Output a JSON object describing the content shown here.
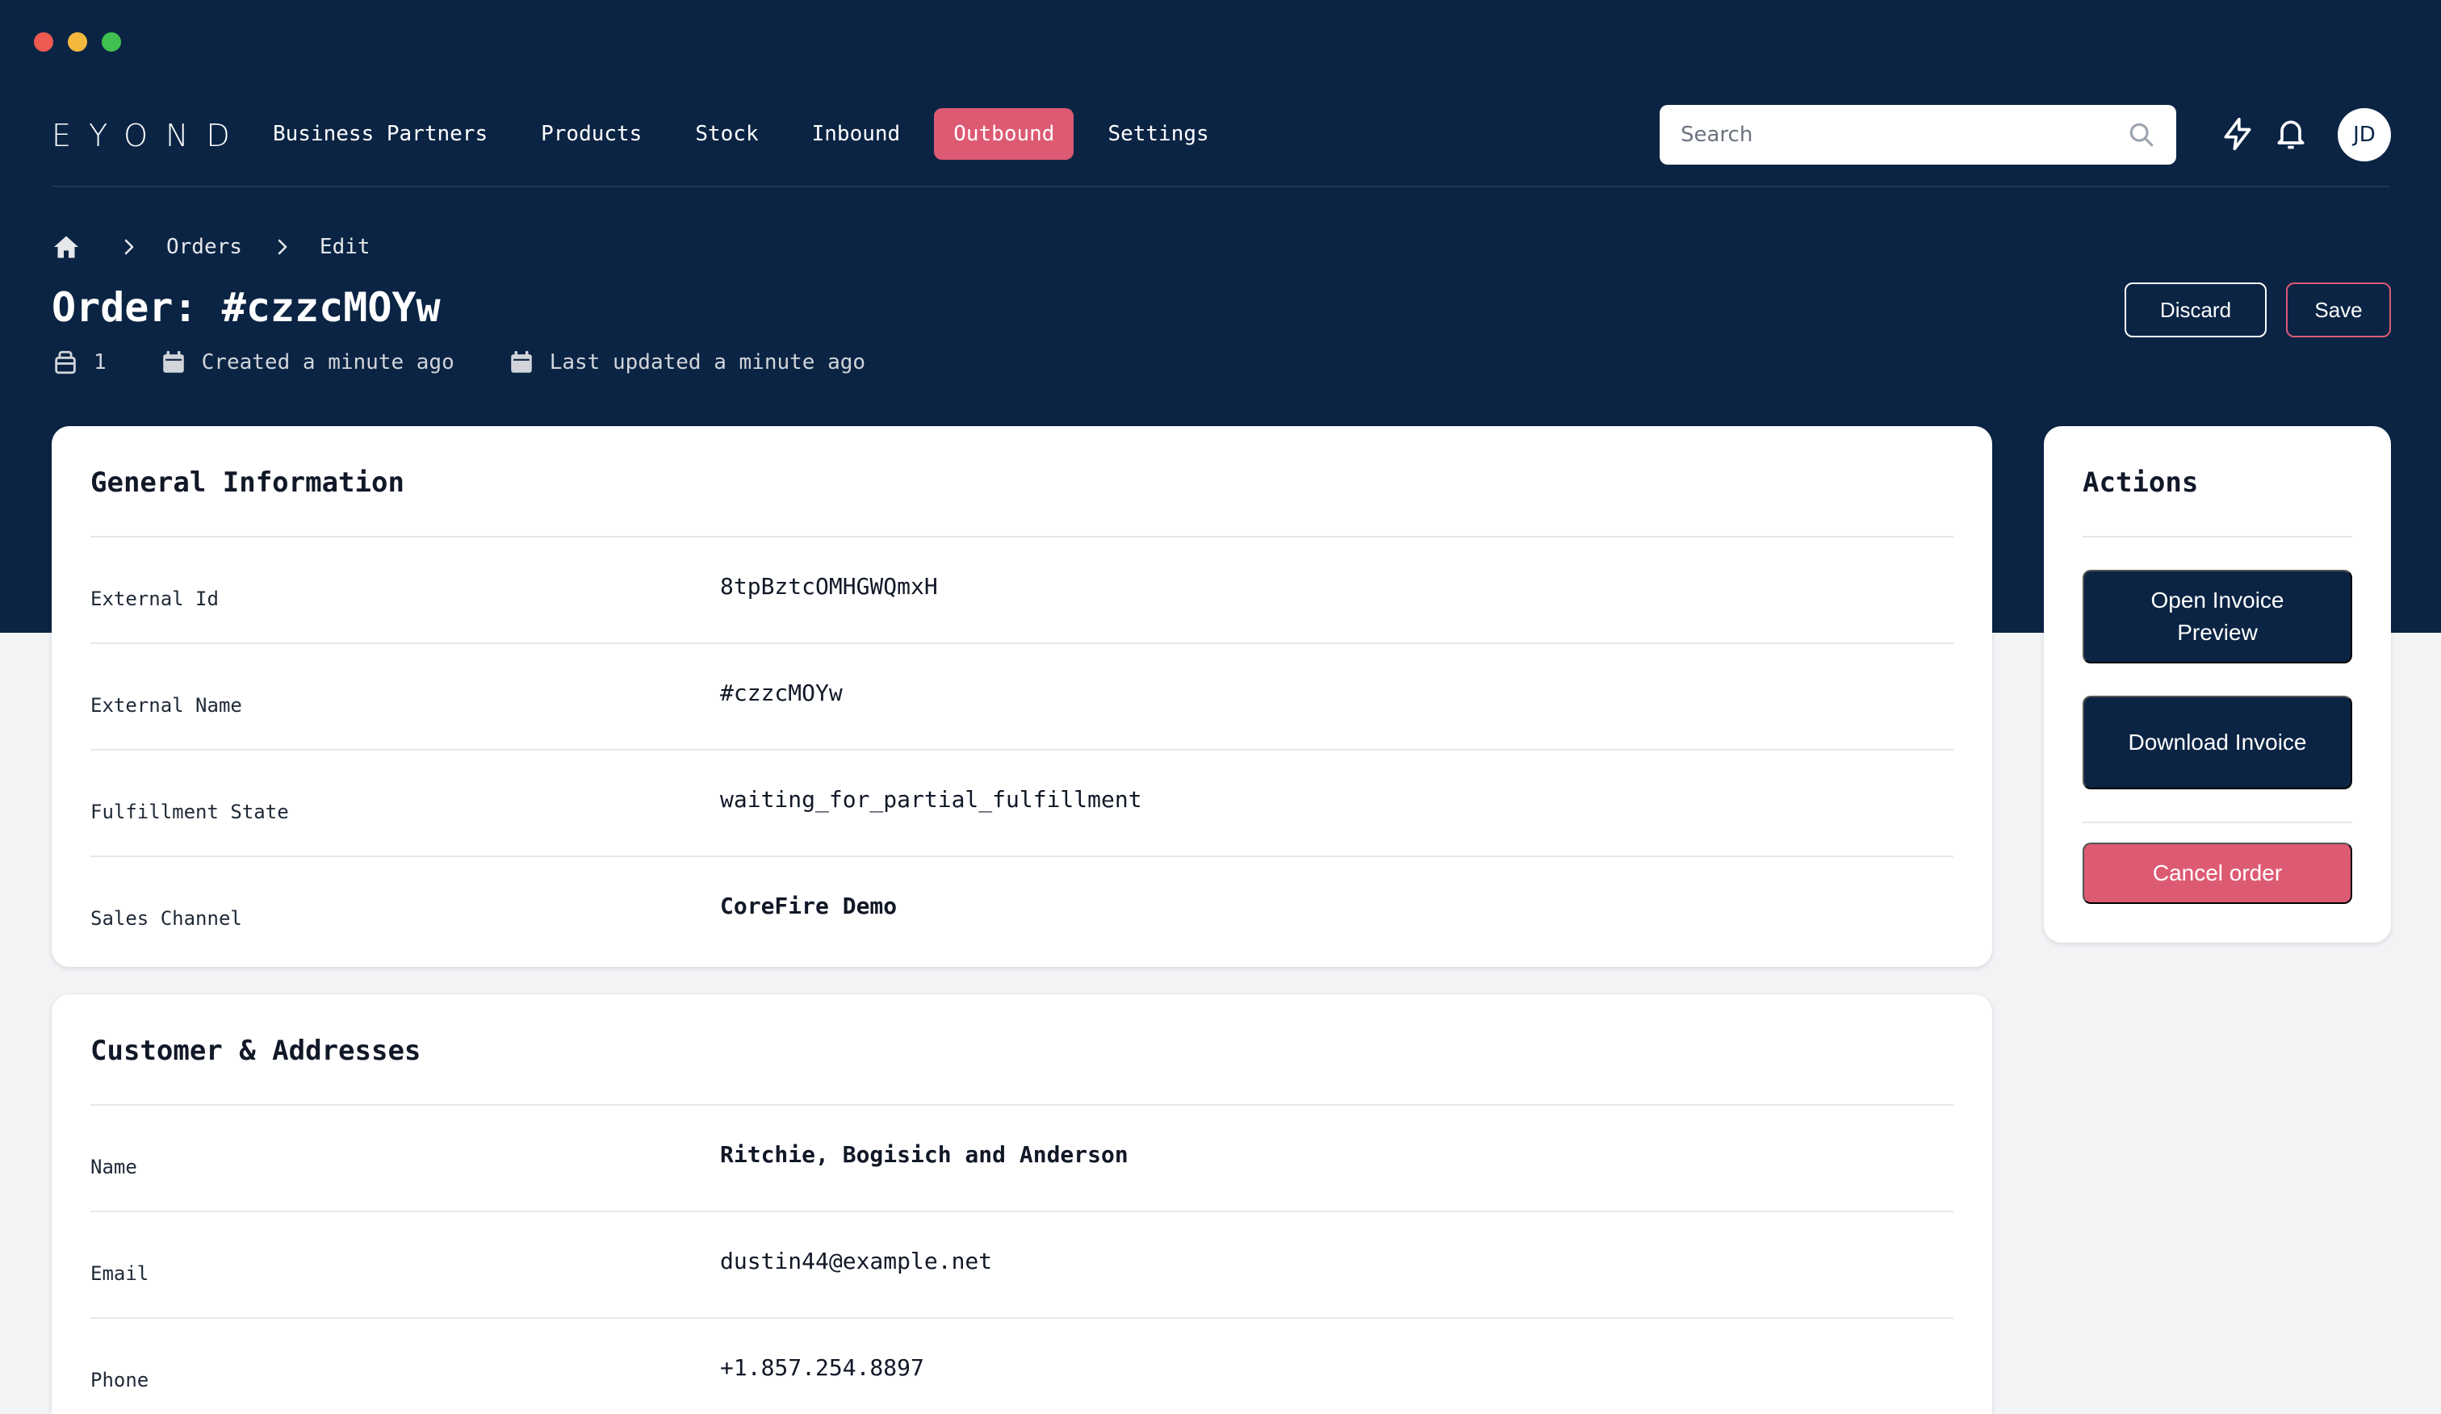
{
  "app": {
    "logo": "EYOND"
  },
  "nav": {
    "items": [
      {
        "label": "Business Partners",
        "active": false
      },
      {
        "label": "Products",
        "active": false
      },
      {
        "label": "Stock",
        "active": false
      },
      {
        "label": "Inbound",
        "active": false
      },
      {
        "label": "Outbound",
        "active": true
      },
      {
        "label": "Settings",
        "active": false
      }
    ]
  },
  "search": {
    "placeholder": "Search",
    "value": ""
  },
  "user": {
    "initials": "JD"
  },
  "breadcrumb": {
    "items": [
      "Orders",
      "Edit"
    ]
  },
  "page": {
    "title": "Order: #czzcMOYw",
    "meta": {
      "count": "1",
      "created": "Created a minute ago",
      "updated": "Last updated a minute ago"
    }
  },
  "toolbar": {
    "discard_label": "Discard",
    "save_label": "Save"
  },
  "general": {
    "title": "General Information",
    "rows": [
      {
        "label": "External Id",
        "value": "8tpBztcOMHGWQmxH"
      },
      {
        "label": "External Name",
        "value": "#czzcMOYw"
      },
      {
        "label": "Fulfillment State",
        "value": "waiting_for_partial_fulfillment"
      },
      {
        "label": "Sales Channel",
        "value": "CoreFire Demo"
      }
    ]
  },
  "customer": {
    "title": "Customer & Addresses",
    "rows": [
      {
        "label": "Name",
        "value": "Ritchie, Bogisich and Anderson"
      },
      {
        "label": "Email",
        "value": "dustin44@example.net"
      },
      {
        "label": "Phone",
        "value": "+1.857.254.8897"
      }
    ]
  },
  "actions": {
    "title": "Actions",
    "open_invoice_label": "Open Invoice Preview",
    "download_invoice_label": "Download Invoice",
    "cancel_label": "Cancel order"
  },
  "colors": {
    "navy": "#0b2444",
    "accent": "#dd5a73",
    "background": "#f2f3f5"
  },
  "icons": [
    "home-icon",
    "chevron-right-icon",
    "search-icon",
    "bolt-icon",
    "bell-icon",
    "package-icon",
    "calendar-icon"
  ]
}
